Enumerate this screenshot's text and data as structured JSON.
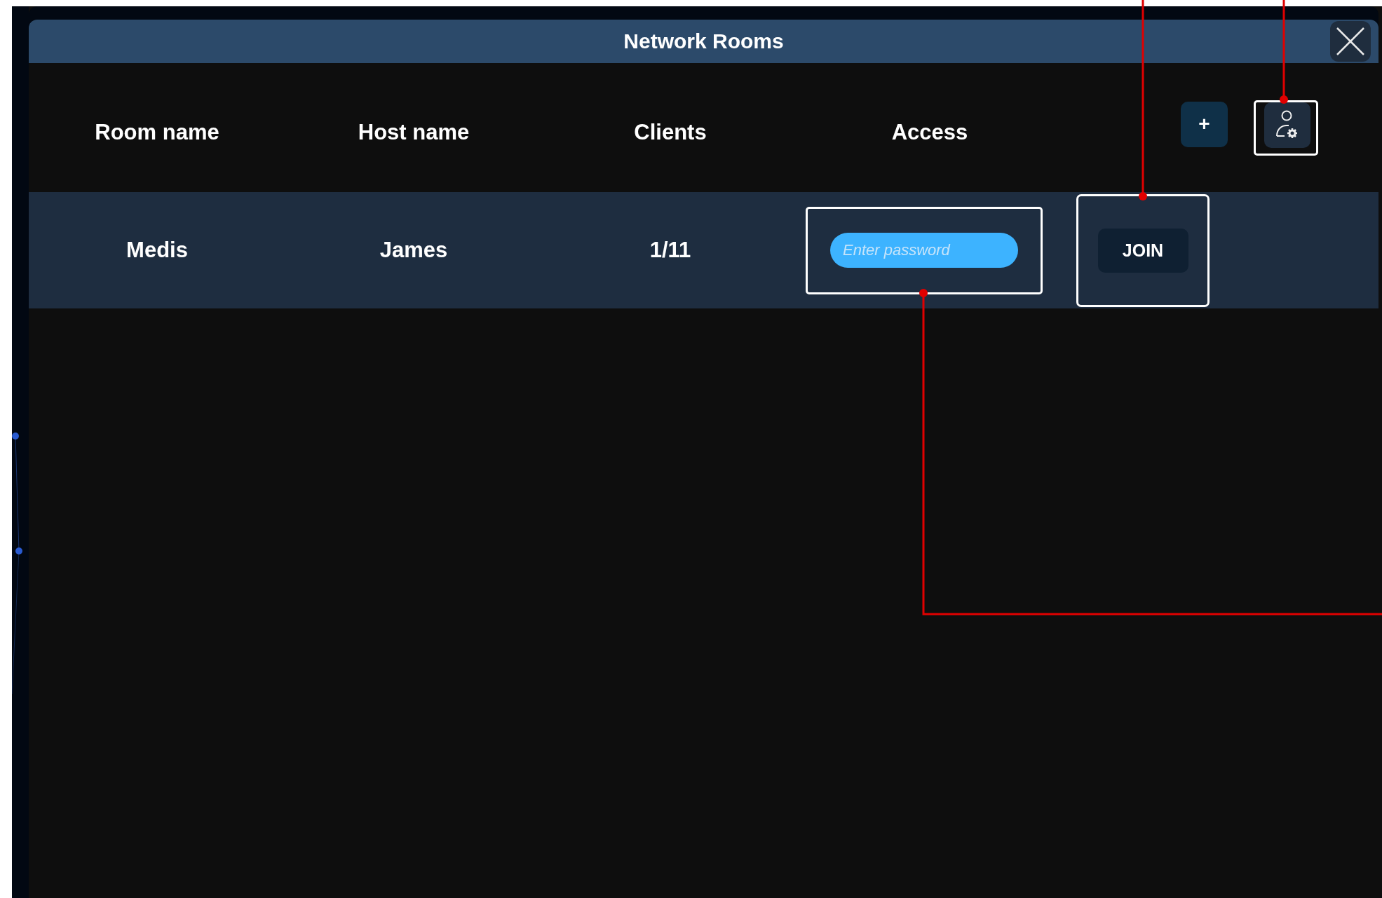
{
  "window": {
    "title": "Network Rooms"
  },
  "toolbar": {
    "add_button": "+"
  },
  "table": {
    "columns": [
      "Room name",
      "Host name",
      "Clients",
      "Access"
    ],
    "rows": [
      {
        "room_name": "Medis",
        "host_name": "James",
        "clients": "1/11",
        "password_placeholder": "Enter password",
        "join_label": "JOIN",
        "highlighted": true
      }
    ]
  }
}
